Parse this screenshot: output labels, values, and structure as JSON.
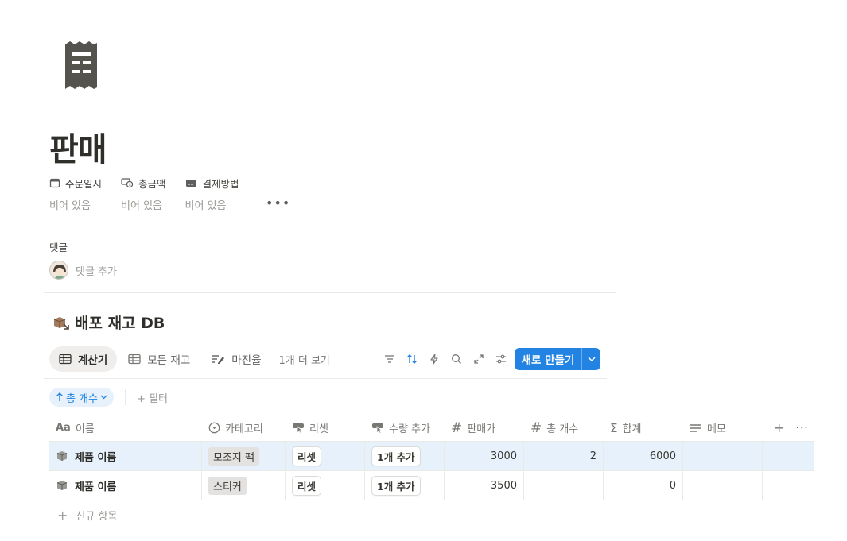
{
  "page": {
    "icon": "receipt-icon",
    "title": "판매"
  },
  "properties": [
    {
      "name": "주문일시",
      "icon": "calendar-icon",
      "value": "비어 있음"
    },
    {
      "name": "총금액",
      "icon": "money-icon",
      "value": "비어 있음"
    },
    {
      "name": "결제방법",
      "icon": "card-icon",
      "value": "비어 있음"
    }
  ],
  "properties_more": "•••",
  "comments": {
    "label": "댓글",
    "add_placeholder": "댓글 추가"
  },
  "database": {
    "icon": "package-icon",
    "title": "배포 재고 DB",
    "views": [
      {
        "label": "계산기",
        "icon": "table-icon",
        "active": true
      },
      {
        "label": "모든 재고",
        "icon": "table-icon",
        "active": false
      },
      {
        "label": "마진율",
        "icon": "chart-edit-icon",
        "active": false
      }
    ],
    "views_more": "1개 더 보기",
    "toolbar": [
      "filter-icon",
      "sort-icon",
      "lightning-icon",
      "search-icon",
      "expand-icon",
      "settings-icon"
    ],
    "new_button": "새로 만들기",
    "sort_pill": "총 개수",
    "filter_add": "+ 필터",
    "columns": [
      {
        "label": "이름",
        "icon": "title-icon"
      },
      {
        "label": "카테고리",
        "icon": "select-icon"
      },
      {
        "label": "리셋",
        "icon": "button-icon"
      },
      {
        "label": "수량 추가",
        "icon": "button-icon"
      },
      {
        "label": "판매가",
        "icon": "number-icon"
      },
      {
        "label": "총 개수",
        "icon": "number-icon"
      },
      {
        "label": "합계",
        "icon": "sum-icon"
      },
      {
        "label": "메모",
        "icon": "text-icon"
      }
    ],
    "rows": [
      {
        "name": "제품 이름",
        "category": "모조지 팩",
        "reset": "리셋",
        "add_qty": "1개 추가",
        "price": "3000",
        "count": "2",
        "sum": "6000",
        "memo": "",
        "selected": true
      },
      {
        "name": "제품 이름",
        "category": "스티커",
        "reset": "리셋",
        "add_qty": "1개 추가",
        "price": "3500",
        "count": "",
        "sum": "0",
        "memo": "",
        "selected": false
      }
    ],
    "new_row": "신규 항목"
  },
  "colors": {
    "accent": "#2383e2",
    "selected_row": "#e7f1fb",
    "tag_bg": "#e3e2e0"
  }
}
